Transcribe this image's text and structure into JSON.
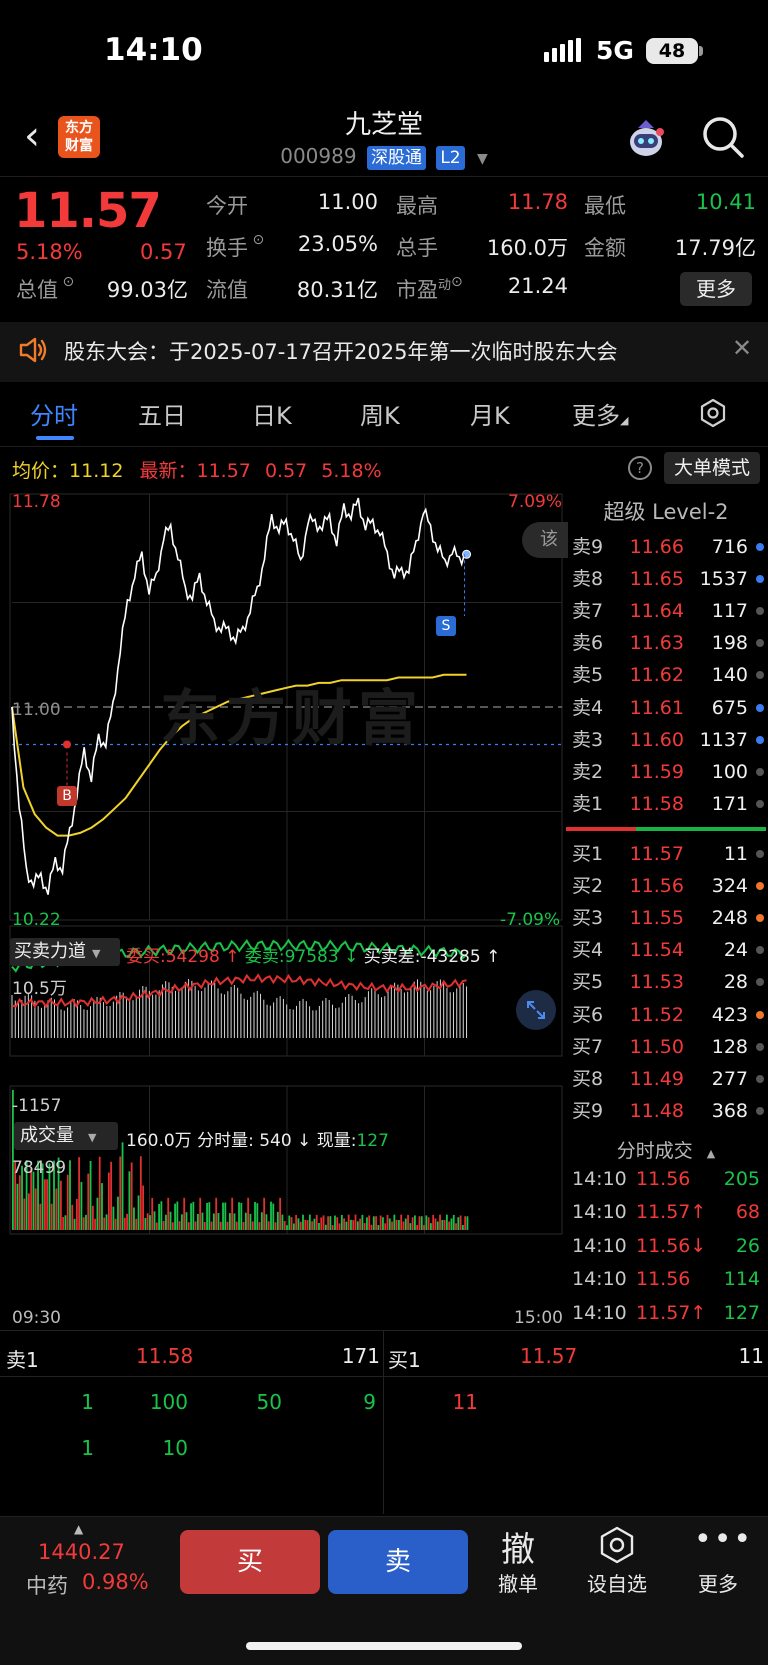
{
  "status_bar": {
    "time": "14:10",
    "network": "5G",
    "battery": "48"
  },
  "header": {
    "title": "九芝堂",
    "code": "000989",
    "connect_tag": "深股通",
    "level_tag": "L2",
    "logo_text": "东方财富"
  },
  "quote": {
    "price": "11.57",
    "pct": "5.18%",
    "change": "0.57",
    "rows": [
      [
        {
          "k": "今开",
          "v": "11.00",
          "c": "white"
        },
        {
          "k": "最高",
          "v": "11.78",
          "c": "red"
        },
        {
          "k": "最低",
          "v": "10.41",
          "c": "green"
        }
      ],
      [
        {
          "k": "换手",
          "v": "23.05%",
          "c": "white"
        },
        {
          "k": "总手",
          "v": "160.0万",
          "c": "white"
        },
        {
          "k": "金额",
          "v": "17.79亿",
          "c": "white"
        }
      ],
      [
        {
          "k": "总值",
          "v": "99.03亿",
          "c": "white"
        },
        {
          "k": "流值",
          "v": "80.31亿",
          "c": "white"
        },
        {
          "k": "市盈",
          "v": "21.24",
          "c": "white"
        }
      ]
    ],
    "pe_suffix": "动",
    "more_label": "更多"
  },
  "notice": {
    "text": "股东大会：于2025-07-17召开2025年第一次临时股东大会"
  },
  "tabs": [
    "分时",
    "五日",
    "日K",
    "周K",
    "月K",
    "更多"
  ],
  "info": {
    "avg_label": "均价：",
    "avg": "11.12",
    "latest_label": "最新：",
    "latest": "11.57",
    "chg": "0.57",
    "pct": "5.18%",
    "help": "?",
    "big_mode": "大单模式"
  },
  "chart": {
    "price_high": "11.78",
    "price_low": "10.22",
    "pct_high": "7.09%",
    "pct_low": "-7.09%",
    "open_line": "11.00",
    "buy_marker": "B",
    "sell_marker": "S",
    "side_tab": "该",
    "watermark": "东方财富",
    "force_title": "买卖力道",
    "weibuy": "委买:54298 ↑",
    "weisell": "委卖:97583 ↓",
    "diff": "买卖差:-43285 ↑",
    "force_max": "10.5万",
    "force_min": "-1157",
    "vol_title": "成交量",
    "vol_total": "160.0万",
    "vol_min_label": "分时量: 540 ↓",
    "vol_now_label": "现量:",
    "vol_now": "127",
    "vol_max": "78499",
    "time_start": "09:30",
    "time_end": "15:00"
  },
  "chart_data": {
    "type": "line",
    "title": "",
    "ylim": [
      10.22,
      11.78
    ],
    "series": [
      {
        "values": [
          11.0,
          10.62,
          10.4,
          10.33,
          10.38,
          10.3,
          10.44,
          10.38,
          10.55,
          10.66,
          10.85,
          10.72,
          10.9,
          10.85,
          11.02,
          11.2,
          11.4,
          11.48,
          11.58,
          11.42,
          11.5,
          11.62,
          11.68,
          11.55,
          11.45,
          11.4,
          11.5,
          11.38,
          11.33,
          11.28,
          11.3,
          11.24,
          11.3,
          11.35,
          11.45,
          11.55,
          11.72,
          11.65,
          11.7,
          11.62,
          11.55,
          11.68,
          11.7,
          11.66,
          11.72,
          11.6,
          11.76,
          11.7,
          11.78,
          11.66,
          11.7,
          11.64,
          11.58,
          11.48,
          11.52,
          11.5,
          11.62,
          11.72,
          11.68,
          11.58,
          11.55,
          11.57,
          11.56,
          11.57
        ],
        "color": "#ffffff"
      },
      {
        "values": [
          11.0,
          10.7,
          10.6,
          10.55,
          10.52,
          10.52,
          10.53,
          10.55,
          10.58,
          10.62,
          10.66,
          10.72,
          10.78,
          10.84,
          10.89,
          10.93,
          10.96,
          10.98,
          11.0,
          11.02,
          11.03,
          11.04,
          11.05,
          11.06,
          11.07,
          11.08,
          11.08,
          11.09,
          11.09,
          11.1,
          11.1,
          11.1,
          11.1,
          11.1,
          11.11,
          11.11,
          11.11,
          11.11,
          11.12,
          11.12,
          11.12
        ],
        "color": "#f0d22a"
      }
    ]
  },
  "order_book": {
    "title": "超级 Level-2",
    "asks": [
      {
        "k": "卖9",
        "p": "11.66",
        "v": "716",
        "d": "#3b7df0"
      },
      {
        "k": "卖8",
        "p": "11.65",
        "v": "1537",
        "d": "#3b7df0"
      },
      {
        "k": "卖7",
        "p": "11.64",
        "v": "117",
        "d": "#555555"
      },
      {
        "k": "卖6",
        "p": "11.63",
        "v": "198",
        "d": "#555555"
      },
      {
        "k": "卖5",
        "p": "11.62",
        "v": "140",
        "d": "#555555"
      },
      {
        "k": "卖4",
        "p": "11.61",
        "v": "675",
        "d": "#3b7df0"
      },
      {
        "k": "卖3",
        "p": "11.60",
        "v": "1137",
        "d": "#3b7df0"
      },
      {
        "k": "卖2",
        "p": "11.59",
        "v": "100",
        "d": "#555555"
      },
      {
        "k": "卖1",
        "p": "11.58",
        "v": "171",
        "d": "#555555"
      }
    ],
    "bids": [
      {
        "k": "买1",
        "p": "11.57",
        "v": "11",
        "d": "#555555"
      },
      {
        "k": "买2",
        "p": "11.56",
        "v": "324",
        "d": "#f0762a"
      },
      {
        "k": "买3",
        "p": "11.55",
        "v": "248",
        "d": "#f0762a"
      },
      {
        "k": "买4",
        "p": "11.54",
        "v": "24",
        "d": "#555555"
      },
      {
        "k": "买5",
        "p": "11.53",
        "v": "28",
        "d": "#555555"
      },
      {
        "k": "买6",
        "p": "11.52",
        "v": "423",
        "d": "#f0762a"
      },
      {
        "k": "买7",
        "p": "11.50",
        "v": "128",
        "d": "#555555"
      },
      {
        "k": "买8",
        "p": "11.49",
        "v": "277",
        "d": "#555555"
      },
      {
        "k": "买9",
        "p": "11.48",
        "v": "368",
        "d": "#555555"
      }
    ],
    "ticks_title": "分时成交",
    "ticks": [
      {
        "t": "14:10",
        "p": "11.56",
        "v": "205",
        "pc": "red",
        "vc": "green"
      },
      {
        "t": "14:10",
        "p": "11.57↑",
        "v": "68",
        "pc": "red",
        "vc": "red"
      },
      {
        "t": "14:10",
        "p": "11.56↓",
        "v": "26",
        "pc": "red",
        "vc": "green"
      },
      {
        "t": "14:10",
        "p": "11.56",
        "v": "114",
        "pc": "red",
        "vc": "green"
      },
      {
        "t": "14:10",
        "p": "11.57↑",
        "v": "127",
        "pc": "red",
        "vc": "green"
      }
    ]
  },
  "queue": {
    "sell_label": "卖1",
    "sell_price": "11.58",
    "sell_total": "171",
    "buy_label": "买1",
    "buy_price": "11.57",
    "buy_total": "11",
    "sell_row1": [
      "1",
      "100",
      "50",
      "9"
    ],
    "sell_row2": [
      "1",
      "10"
    ],
    "buy_row1": [
      "11"
    ]
  },
  "bottom": {
    "index_value": "1440.27",
    "index_name": "中药",
    "index_pct": "0.98%",
    "buy": "买",
    "sell": "卖",
    "cancel_icon": "撤",
    "cancel_label": "撤单",
    "fav_label": "设自选",
    "more_label": "更多"
  }
}
